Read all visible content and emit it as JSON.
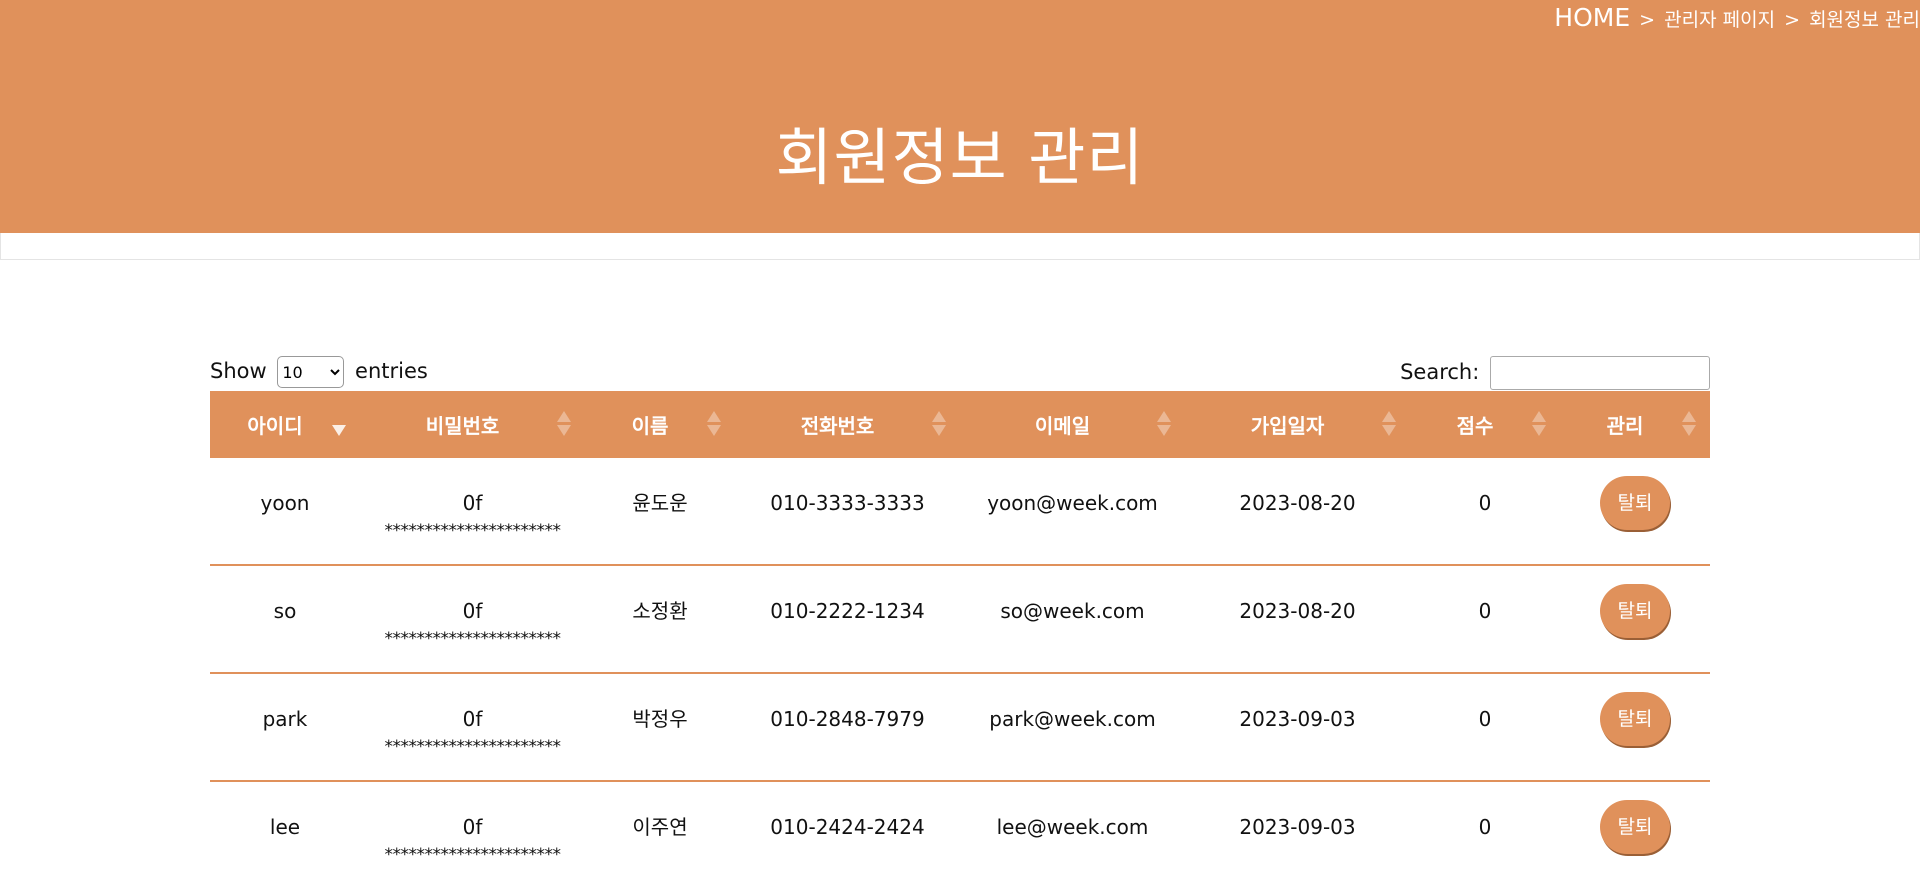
{
  "breadcrumb": {
    "home": "HOME",
    "sep1": ">",
    "admin": "관리자 페이지",
    "sep2": ">",
    "current": "회원정보 관리"
  },
  "page_title": "회원정보 관리",
  "length_menu": {
    "prefix": "Show",
    "selected": "10",
    "suffix": "entries"
  },
  "search": {
    "label": "Search:",
    "value": ""
  },
  "columns": [
    {
      "label": "아이디",
      "sorted": "asc"
    },
    {
      "label": "비밀번호",
      "sorted": "none"
    },
    {
      "label": "이름",
      "sorted": "none"
    },
    {
      "label": "전화번호",
      "sorted": "none"
    },
    {
      "label": "이메일",
      "sorted": "none"
    },
    {
      "label": "가입일자",
      "sorted": "none"
    },
    {
      "label": "점수",
      "sorted": "none"
    },
    {
      "label": "관리",
      "sorted": "none"
    }
  ],
  "rows": [
    {
      "id": "yoon",
      "pw_first": "0f",
      "pw_rest": "**********************",
      "name": "윤도운",
      "phone": "010-3333-3333",
      "email": "yoon@week.com",
      "joined": "2023-08-20",
      "score": "0",
      "action": "탈퇴"
    },
    {
      "id": "so",
      "pw_first": "0f",
      "pw_rest": "**********************",
      "name": "소정환",
      "phone": "010-2222-1234",
      "email": "so@week.com",
      "joined": "2023-08-20",
      "score": "0",
      "action": "탈퇴"
    },
    {
      "id": "park",
      "pw_first": "0f",
      "pw_rest": "**********************",
      "name": "박정우",
      "phone": "010-2848-7979",
      "email": "park@week.com",
      "joined": "2023-09-03",
      "score": "0",
      "action": "탈퇴"
    },
    {
      "id": "lee",
      "pw_first": "0f",
      "pw_rest": "**********************",
      "name": "이주연",
      "phone": "010-2424-2424",
      "email": "lee@week.com",
      "joined": "2023-09-03",
      "score": "0",
      "action": "탈퇴"
    }
  ],
  "colors": {
    "accent": "#e0915b",
    "text": "#111111",
    "header_text": "#ffffff"
  }
}
